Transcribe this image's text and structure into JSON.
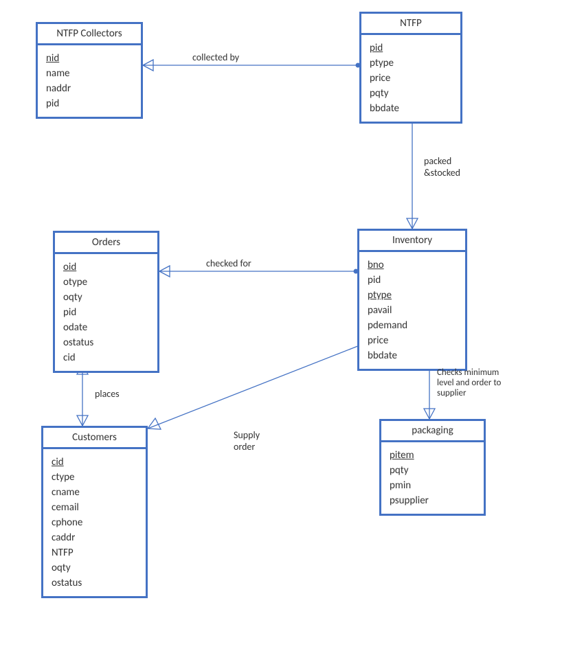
{
  "entities": {
    "ntfp_collectors": {
      "title": "NTFP Collectors",
      "attrs": [
        "nid",
        "name",
        "naddr",
        "pid"
      ],
      "pk": [
        "nid"
      ]
    },
    "ntfp": {
      "title": "NTFP",
      "attrs": [
        "pid",
        "ptype",
        "price",
        "pqty",
        "bbdate"
      ],
      "pk": [
        "pid"
      ]
    },
    "orders": {
      "title": "Orders",
      "attrs": [
        "oid",
        "otype",
        "oqty",
        "pid",
        "odate",
        "ostatus",
        "cid"
      ],
      "pk": [
        "oid"
      ]
    },
    "inventory": {
      "title": "Inventory",
      "attrs": [
        "bno",
        "pid",
        "ptype",
        "pavail",
        "pdemand",
        "price",
        "bbdate"
      ],
      "pk": [
        "bno",
        "ptype"
      ]
    },
    "customers": {
      "title": "Customers",
      "attrs": [
        "cid",
        "ctype",
        "cname",
        "cemail",
        "cphone",
        "caddr",
        "NTFP",
        "oqty",
        "ostatus"
      ],
      "pk": [
        "cid"
      ]
    },
    "packaging": {
      "title": "packaging",
      "attrs": [
        "pitem",
        "pqty",
        "pmin",
        "psupplier"
      ],
      "pk": [
        "pitem"
      ]
    }
  },
  "relationships": {
    "collected_by": "collected by",
    "packed_stocked": "packed\n&stocked",
    "checked_for": "checked for",
    "places": "places",
    "supply_order": "Supply\norder",
    "checks_min": "Checks minimum\nlevel and order to\nsupplier"
  }
}
